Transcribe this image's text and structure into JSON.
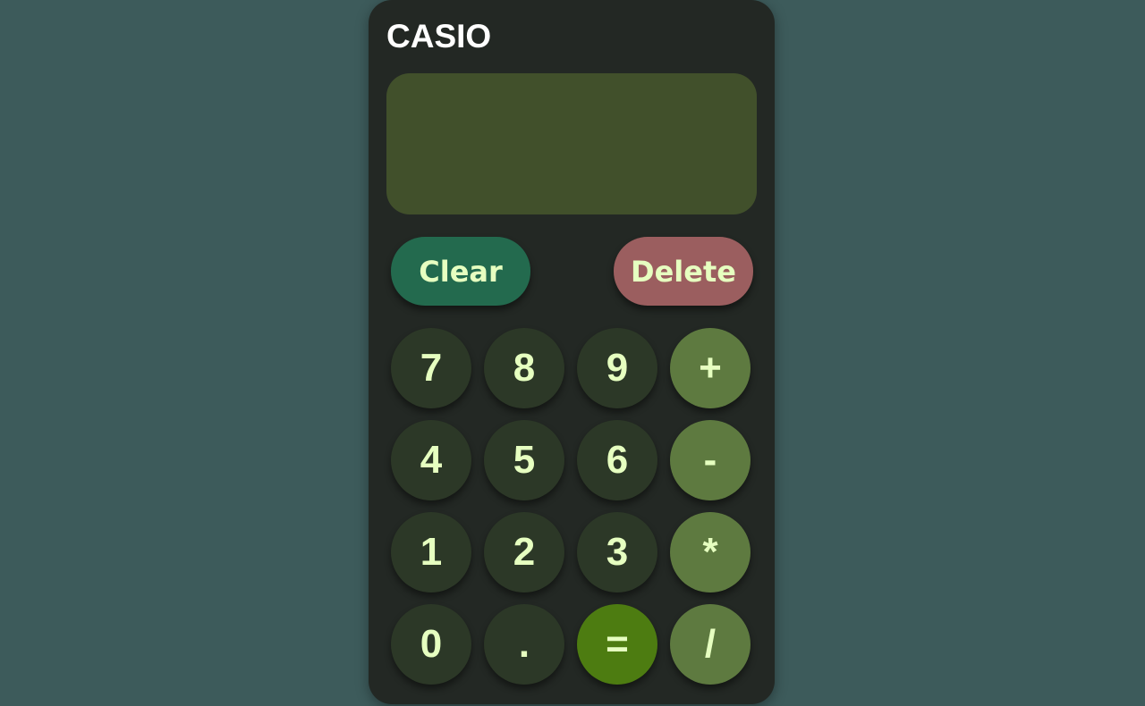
{
  "calculator": {
    "brand": "CASIO",
    "display_value": "",
    "actions": {
      "clear_label": "Clear",
      "delete_label": "Delete"
    },
    "keys": {
      "k7": "7",
      "k8": "8",
      "k9": "9",
      "plus": "+",
      "k4": "4",
      "k5": "5",
      "k6": "6",
      "minus": "-",
      "k1": "1",
      "k2": "2",
      "k3": "3",
      "multiply": "*",
      "k0": "0",
      "dot": ".",
      "equals": "=",
      "divide": "/"
    }
  },
  "colors": {
    "page_background": "#3d5b5b",
    "body": "#232824",
    "display": "#41502b",
    "clear_button": "#236a4e",
    "delete_button": "#9b5e5f",
    "digit_key": "#2c3827",
    "operator_key": "#5e7a40",
    "equals_key": "#4d7c11",
    "key_text": "#e6ffc0"
  }
}
